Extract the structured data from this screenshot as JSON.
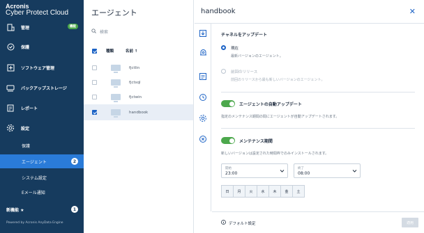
{
  "brand": {
    "line1": "Acronis",
    "line2": "Cyber Protect Cloud"
  },
  "sidebar": {
    "items": [
      {
        "label": "管理",
        "icon": "building-icon",
        "badge": "機能"
      },
      {
        "label": "保護",
        "icon": "shield-icon"
      },
      {
        "label": "ソフトウェア管理",
        "icon": "software-icon"
      },
      {
        "label": "バックアップストレージ",
        "icon": "storage-icon"
      },
      {
        "label": "レポート",
        "icon": "report-icon"
      },
      {
        "label": "設定",
        "icon": "gear-icon"
      }
    ],
    "sub_items": [
      {
        "label": "保護"
      },
      {
        "label": "エージェント",
        "count": "2"
      },
      {
        "label": "システム設定"
      },
      {
        "label": "Eメール通知"
      }
    ],
    "new_label": "新機能 ★",
    "new_count": "1",
    "powered": "Powered by Acronis AnyData Engine"
  },
  "list": {
    "title": "エージェント",
    "search_placeholder": "検索",
    "col_type": "種類",
    "col_name": "名前 ↑",
    "rows": [
      {
        "name": "fjctlin",
        "selected": false
      },
      {
        "name": "fjctsql",
        "selected": false
      },
      {
        "name": "fjctwin",
        "selected": false
      },
      {
        "name": "handbook",
        "selected": true
      }
    ]
  },
  "panel": {
    "title": "handbook",
    "channel_title": "チャネルをアップデート",
    "opt_current_label": "現在",
    "opt_current_desc": "最新バージョンのエージェント。",
    "opt_previous_label": "前回のリリース",
    "opt_previous_desc": "前回のリリースから最も新しいバージョンのエージェント。",
    "auto_update_label": "エージェントの自動アップデート",
    "auto_update_desc": "指定のメンテナンス期間の間にエージェントが自動アップデートされます。",
    "maintenance_label": "メンテナンス期間",
    "maintenance_desc": "新しいバージョンは設定された時間枠でのみインストールされます。",
    "start_label": "開始",
    "start_value": "23:00",
    "end_label": "終了",
    "end_value": "08:00",
    "days": [
      "日",
      "月",
      "火",
      "水",
      "木",
      "金",
      "土"
    ],
    "default_settings": "デフォルト設定",
    "apply": "適用"
  },
  "colors": {
    "sidebar": "#163b5e",
    "accent": "#1b62c5",
    "active": "#2a7bd8",
    "toggle": "#4ca84c"
  }
}
